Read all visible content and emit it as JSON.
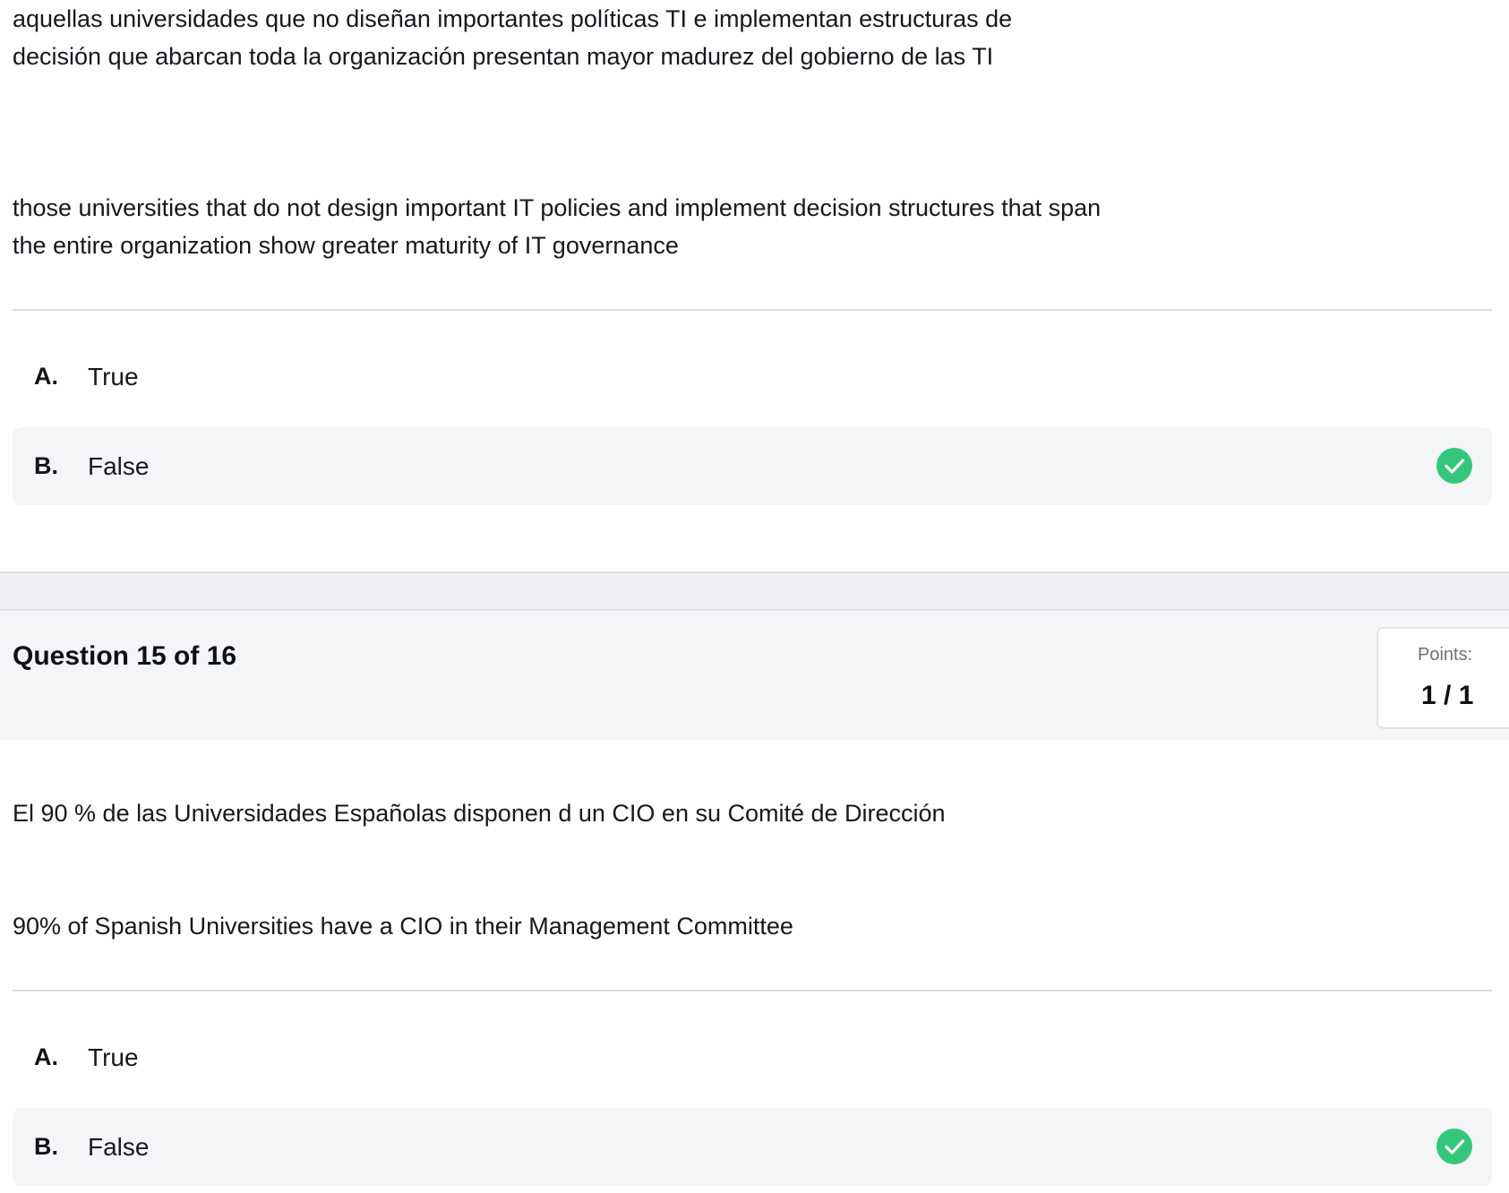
{
  "previous_question": {
    "text_es": "aquellas universidades que no diseñan importantes políticas TI e implementan estructuras de decisión que abarcan toda la organización presentan mayor madurez del gobierno de las TI",
    "text_en": "those universities that do not design important IT policies and implement decision structures that span the entire organization show greater maturity of IT governance",
    "options": [
      {
        "letter": "A.",
        "label": "True",
        "selected": false
      },
      {
        "letter": "B.",
        "label": "False",
        "selected": true,
        "status_icon": "check-circle-icon"
      }
    ]
  },
  "current_question": {
    "title": "Question 15 of 16",
    "points_label": "Points:",
    "points_value": "1 / 1",
    "text_es": "El 90 % de las Universidades Españolas disponen d un CIO en su Comité de Dirección",
    "text_en": "90% of Spanish Universities have a CIO in their Management Committee",
    "options": [
      {
        "letter": "A.",
        "label": "True",
        "selected": false
      },
      {
        "letter": "B.",
        "label": "False",
        "selected": true,
        "status_icon": "check-circle-icon"
      }
    ]
  },
  "colors": {
    "correct_green": "#34c77b",
    "selected_bg": "#f4f5f7",
    "divider": "#dadde2"
  }
}
